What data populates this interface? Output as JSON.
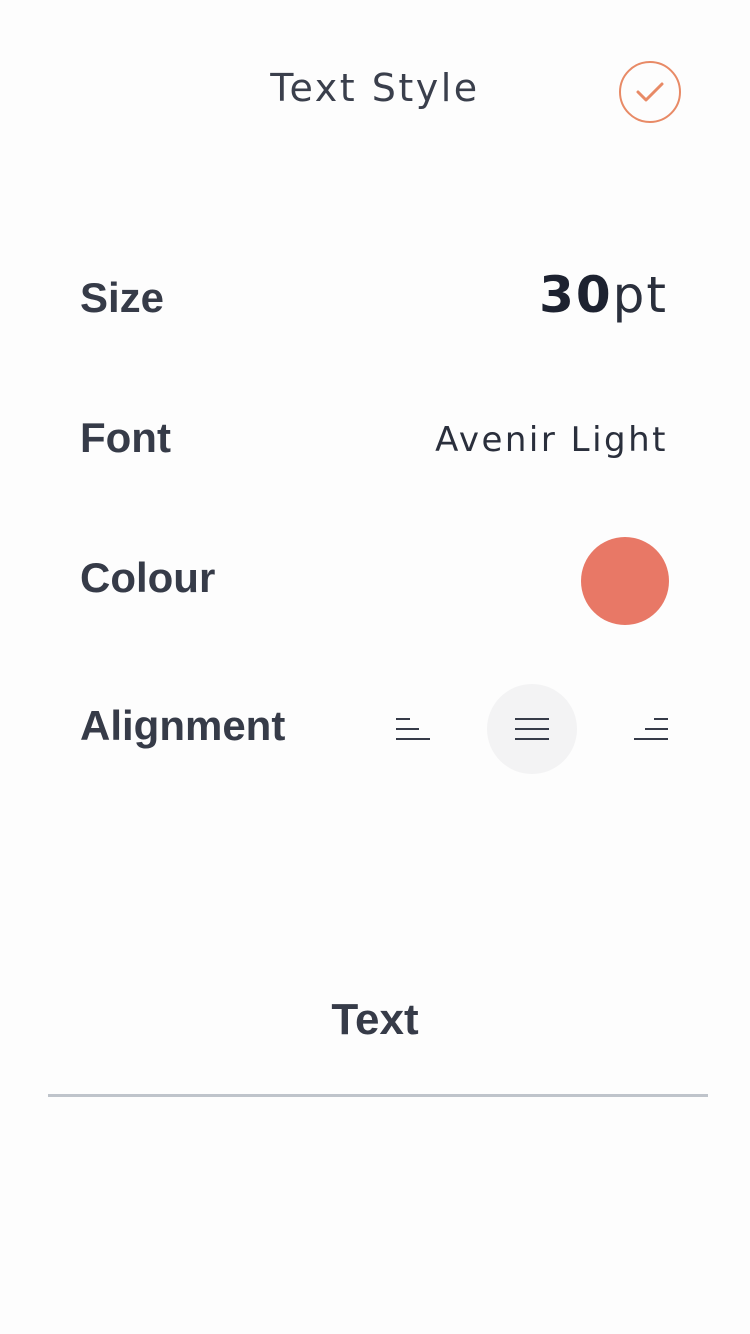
{
  "header": {
    "title": "Text Style",
    "confirm_icon": "checkmark-icon"
  },
  "colors": {
    "accent": "#e88a66",
    "selected_colour": "#e87866"
  },
  "settings": {
    "size_label": "Size",
    "size_value": "30",
    "size_unit": "pt",
    "font_label": "Font",
    "font_value": "Avenir Light",
    "colour_label": "Colour",
    "alignment_label": "Alignment",
    "alignment_options": [
      {
        "name": "align-left",
        "icon": "align-left-icon",
        "selected": false
      },
      {
        "name": "align-center",
        "icon": "align-center-icon",
        "selected": true
      },
      {
        "name": "align-right",
        "icon": "align-right-icon",
        "selected": false
      }
    ]
  },
  "preview": {
    "text": "Text"
  }
}
